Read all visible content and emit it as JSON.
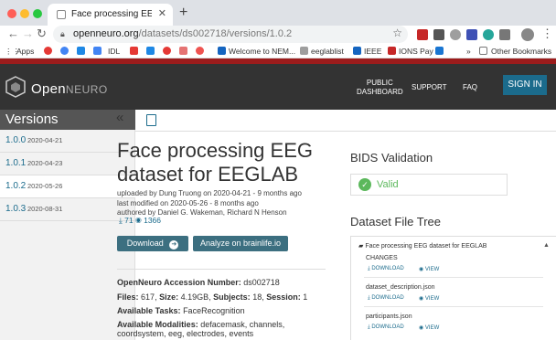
{
  "browser": {
    "tab_title": "Face processing EEG dataset f",
    "url_host": "openneuro.org",
    "url_path": "/datasets/ds002718/versions/1.0.2",
    "bookmarks": [
      "Apps",
      "IDL",
      "Welcome to NEM...",
      "eeglablist",
      "IEEE",
      "IONS Pay",
      "Other Bookmarks"
    ]
  },
  "header": {
    "logo_main": "Open",
    "logo_light": "NEURO",
    "nav_public": "PUBLIC",
    "nav_dashboard": "DASHBOARD",
    "nav_support": "SUPPORT",
    "nav_faq": "FAQ",
    "signin": "SIGN IN"
  },
  "sidebar": {
    "title": "Versions",
    "collapse_icon": "«",
    "versions": [
      {
        "version": "1.0.0",
        "date": "2020-04-21"
      },
      {
        "version": "1.0.1",
        "date": "2020-04-23"
      },
      {
        "version": "1.0.2",
        "date": "2020-05-26"
      },
      {
        "version": "1.0.3",
        "date": "2020-08-31"
      }
    ]
  },
  "dataset": {
    "title": "Face processing EEG dataset for EEGLAB",
    "uploaded": "uploaded by Dung Truong on 2020-04-21 - 9 months ago",
    "modified": "last modified on 2020-05-26 - 8 months ago",
    "authored": "authored by Daniel G. Wakeman, Richard N Henson",
    "downloads": "71",
    "views": "1366",
    "download_button": "Download",
    "brainlife_button": "Analyze on brainlife.io",
    "accession_label": "OpenNeuro Accession Number:",
    "accession": "ds002718",
    "files_label": "Files:",
    "files": "617",
    "size_label": "Size:",
    "size": "4.19GB",
    "subjects_label": "Subjects:",
    "subjects": "18",
    "session_label": "Session:",
    "session": "1",
    "tasks_label": "Available Tasks:",
    "tasks": "FaceRecognition",
    "modalities_label": "Available Modalities:",
    "modalities_1": "defacemask, channels,",
    "modalities_2": "coordsystem, eeg, electrodes, events"
  },
  "bids": {
    "heading": "BIDS Validation",
    "status": "Valid"
  },
  "tree": {
    "heading": "Dataset File Tree",
    "root": "Face processing EEG dataset for EEGLAB",
    "download_label": "DOWNLOAD",
    "view_label": "VIEW",
    "files": [
      "CHANGES",
      "dataset_description.json",
      "participants.json"
    ]
  },
  "colors": {
    "accent": "#1b6b8c",
    "header_bg": "#333333",
    "valid": "#5cb85c",
    "red_bar": "#9b1c1c"
  }
}
